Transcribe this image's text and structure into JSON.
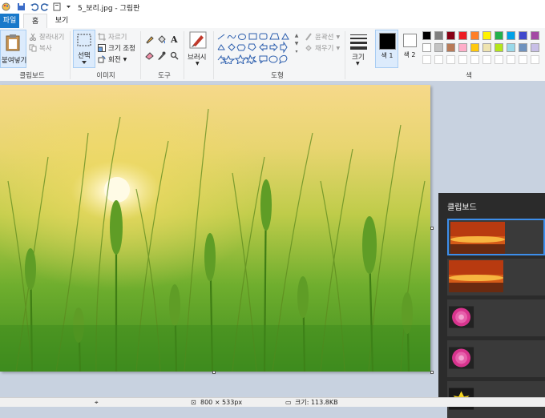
{
  "window": {
    "title": "5_보리.jpg - 그림판"
  },
  "tabs": {
    "file": "파일",
    "home": "홈",
    "view": "보기"
  },
  "clipboard_group": {
    "paste": "붙여넣기",
    "cut": "잘라내기",
    "copy": "복사",
    "label": "클립보드"
  },
  "image_group": {
    "select": "선택",
    "crop": "자르기",
    "resize": "크기 조정",
    "rotate": "회전",
    "label": "이미지"
  },
  "tools_group": {
    "label": "도구"
  },
  "brushes": {
    "label": "브러시"
  },
  "shapes_group": {
    "outline": "윤곽선",
    "fill": "채우기",
    "label": "도형"
  },
  "size": {
    "label": "크기"
  },
  "color1": {
    "label": "색\n1",
    "text": "색 1"
  },
  "color2": {
    "text": "색 2"
  },
  "colors_group": {
    "label": "색",
    "row1": [
      "#000000",
      "#7f7f7f",
      "#880015",
      "#ed1c24",
      "#ff7f27",
      "#fff200",
      "#22b14c",
      "#00a2e8",
      "#3f48cc",
      "#a349a4"
    ],
    "row2": [
      "#ffffff",
      "#c3c3c3",
      "#b97a57",
      "#ffaec9",
      "#ffc90e",
      "#efe4b0",
      "#b5e61d",
      "#99d9ea",
      "#7092be",
      "#c8bfe7"
    ]
  },
  "clipboard_panel": {
    "title": "클립보드",
    "items": [
      "sunset-thumbnail",
      "sunset-thumbnail",
      "pink-dahlia-thumbnail",
      "pink-dahlia-thumbnail",
      "yellow-flower-thumbnail"
    ]
  },
  "status": {
    "dimensions": "800 × 533px",
    "file_size": "크기: 113.8KB"
  },
  "colors": {
    "accent": "#1979ca",
    "selection": "#3d8eea"
  }
}
